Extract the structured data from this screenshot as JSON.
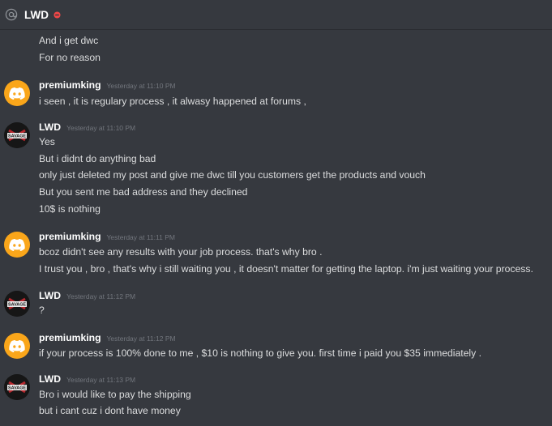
{
  "header": {
    "channel_name": "LWD",
    "at_icon": "at-icon",
    "status_icon": "dnd-status-icon",
    "status_color": "#f04747"
  },
  "colors": {
    "background": "#36393f",
    "text": "#dcddde",
    "author": "#ffffff",
    "timestamp": "#72767d",
    "discord_avatar": "#faa61a"
  },
  "messages": [
    {
      "continuation": true,
      "lines": [
        "And i get dwc",
        "For no reason"
      ]
    },
    {
      "author": "premiumking",
      "avatar": "discord-logo-avatar",
      "timestamp": "Yesterday at 11:10 PM",
      "lines": [
        "i seen , it is regulary process , it alwasy happened at forums ,"
      ]
    },
    {
      "author": "LWD",
      "avatar": "lwd-avatar",
      "avatar_text": "SAVAGE",
      "timestamp": "Yesterday at 11:10 PM",
      "lines": [
        "Yes",
        "But i didnt do anything bad",
        "only just deleted my post and give me dwc till you customers get the products and vouch",
        "But you sent me bad address and they declined",
        "10$ is nothing"
      ]
    },
    {
      "author": "premiumking",
      "avatar": "discord-logo-avatar",
      "timestamp": "Yesterday at 11:11 PM",
      "lines": [
        "bcoz didn't see any results with your job process. that's why bro .",
        "I trust you , bro , that's why i still waiting you , it doesn't matter for getting the laptop. i'm just waiting your process."
      ]
    },
    {
      "author": "LWD",
      "avatar": "lwd-avatar",
      "avatar_text": "SAVAGE",
      "timestamp": "Yesterday at 11:12 PM",
      "lines": [
        "?"
      ]
    },
    {
      "author": "premiumking",
      "avatar": "discord-logo-avatar",
      "timestamp": "Yesterday at 11:12 PM",
      "lines": [
        "if your process is 100% done to me , $10 is nothing to give you. first time i paid you $35 immediately ."
      ]
    },
    {
      "author": "LWD",
      "avatar": "lwd-avatar",
      "avatar_text": "SAVAGE",
      "timestamp": "Yesterday at 11:13 PM",
      "lines": [
        "Bro i would like to pay the shipping",
        "but i cant cuz i dont have money"
      ]
    }
  ]
}
